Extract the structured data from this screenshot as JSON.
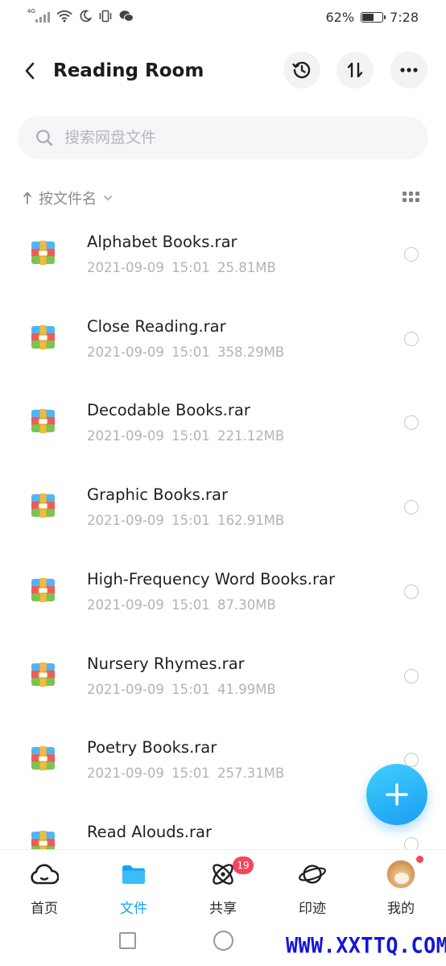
{
  "status_bar": {
    "network": "4G",
    "battery_percent": "62%",
    "battery_level": 0.62,
    "time": "7:28"
  },
  "header": {
    "title": "Reading Room"
  },
  "search": {
    "placeholder": "搜索网盘文件"
  },
  "sort": {
    "label": "按文件名"
  },
  "files": [
    {
      "name": "Alphabet Books.rar",
      "date": "2021-09-09",
      "time": "15:01",
      "size": "25.81MB"
    },
    {
      "name": "Close Reading.rar",
      "date": "2021-09-09",
      "time": "15:01",
      "size": "358.29MB"
    },
    {
      "name": "Decodable Books.rar",
      "date": "2021-09-09",
      "time": "15:01",
      "size": "221.12MB"
    },
    {
      "name": "Graphic Books.rar",
      "date": "2021-09-09",
      "time": "15:01",
      "size": "162.91MB"
    },
    {
      "name": "High-Frequency Word Books.rar",
      "date": "2021-09-09",
      "time": "15:01",
      "size": "87.30MB"
    },
    {
      "name": "Nursery Rhymes.rar",
      "date": "2021-09-09",
      "time": "15:01",
      "size": "41.99MB"
    },
    {
      "name": "Poetry Books.rar",
      "date": "2021-09-09",
      "time": "15:01",
      "size": "257.31MB"
    },
    {
      "name": "Read Alouds.rar",
      "date": "",
      "time": "",
      "size": ""
    }
  ],
  "bottom_nav": {
    "items": [
      {
        "label": "首页",
        "icon": "cloud-icon"
      },
      {
        "label": "文件",
        "icon": "folder-icon",
        "active": true
      },
      {
        "label": "共享",
        "icon": "orbit-icon",
        "badge": "19"
      },
      {
        "label": "印迹",
        "icon": "planet-icon"
      },
      {
        "label": "我的",
        "icon": "avatar"
      }
    ]
  },
  "watermark": "WWW.XXTTQ.COM",
  "colors": {
    "accent": "#17a2f3",
    "badge": "#f5455f",
    "fab_start": "#3fd0fb",
    "fab_end": "#1b9cf4"
  }
}
